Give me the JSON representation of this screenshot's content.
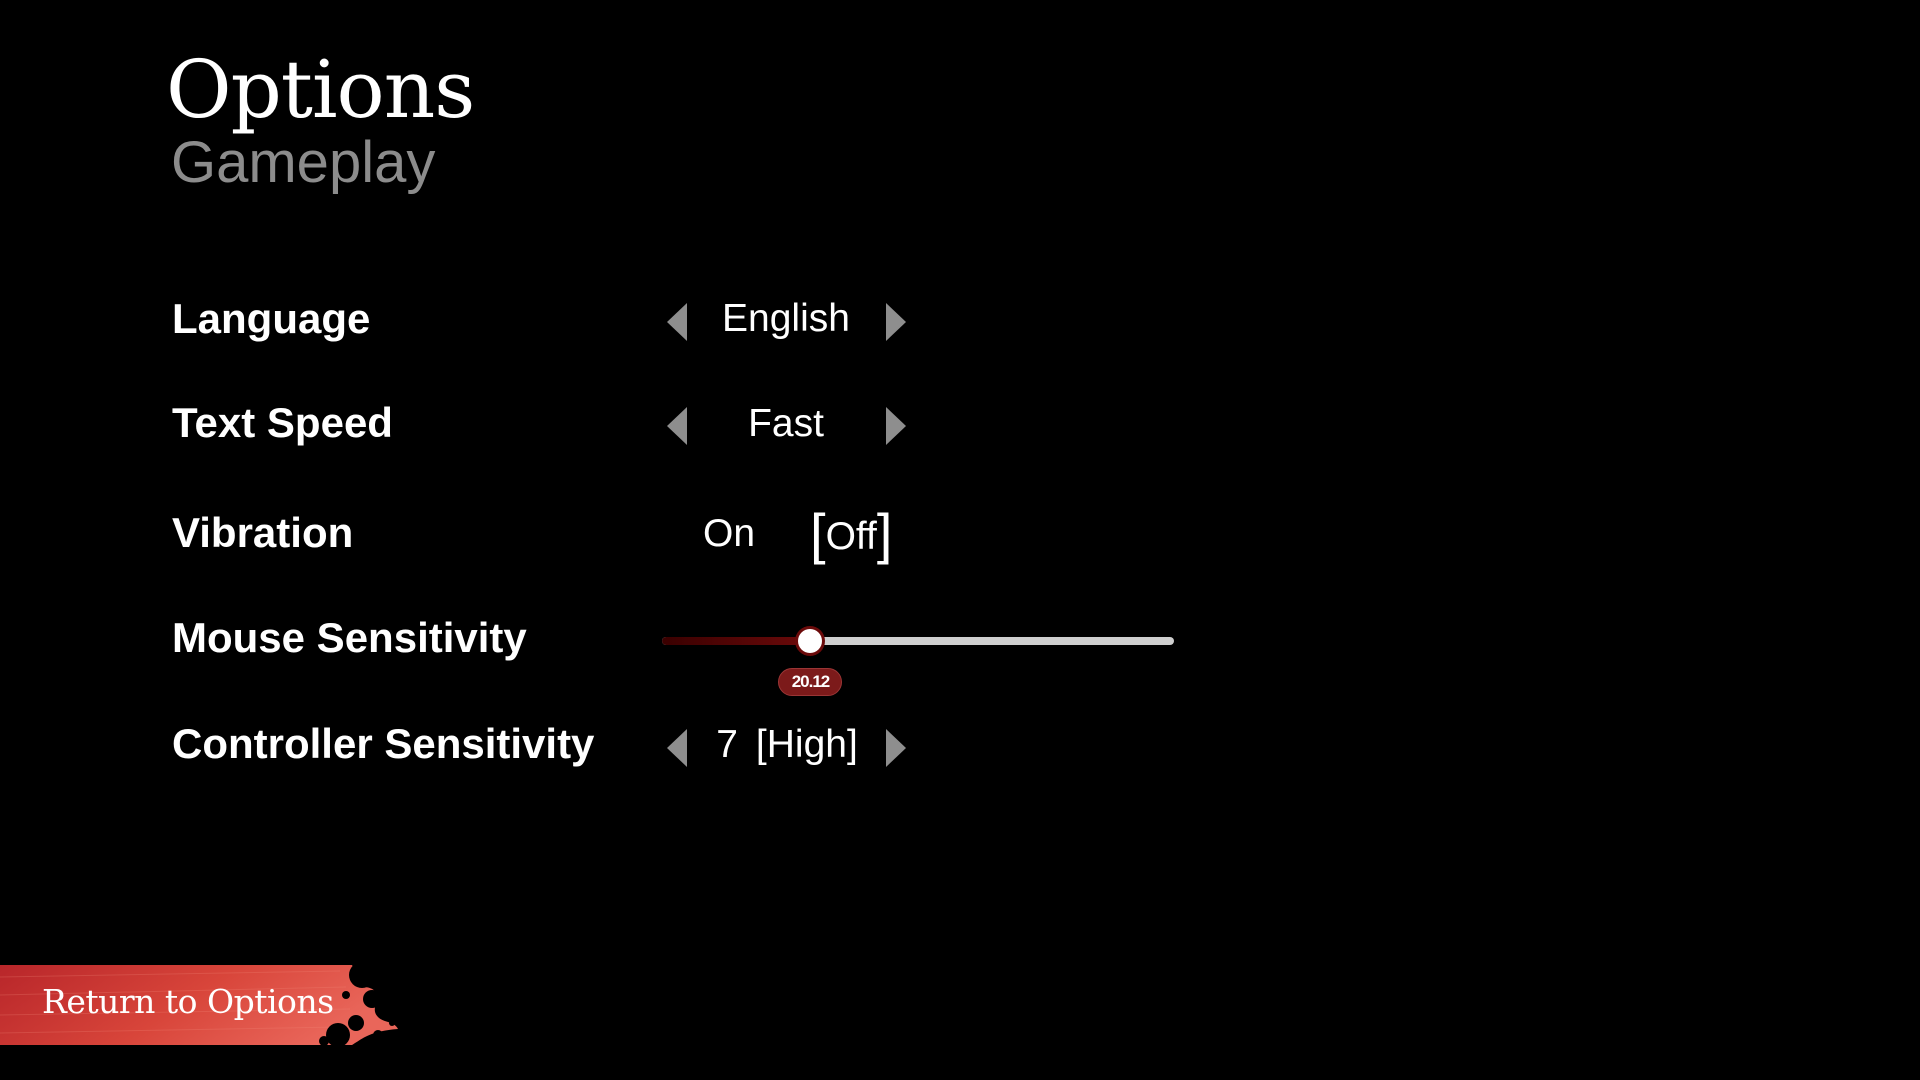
{
  "header": {
    "title": "Options",
    "subtitle": "Gameplay"
  },
  "settings": {
    "language": {
      "label": "Language",
      "value": "English"
    },
    "text_speed": {
      "label": "Text Speed",
      "value": "Fast"
    },
    "vibration": {
      "label": "Vibration",
      "option_on": "On",
      "option_off": "Off",
      "selected": "Off"
    },
    "mouse_sensitivity": {
      "label": "Mouse Sensitivity",
      "value_text": "20.12",
      "fraction": 0.29
    },
    "controller_sensitivity": {
      "label": "Controller Sensitivity",
      "value": "7",
      "level": "[High]"
    }
  },
  "footer": {
    "return_label": "Return to Options"
  },
  "colors": {
    "background": "#000000",
    "accent": "#c8302f",
    "slider_fill": "#6b0a0a",
    "arrow": "#8e8e8e",
    "subtitle": "#8c8c8c"
  },
  "icons": {
    "left_arrow": "caret-left-icon",
    "right_arrow": "caret-right-icon",
    "paint_splatter": "splatter-decoration"
  }
}
